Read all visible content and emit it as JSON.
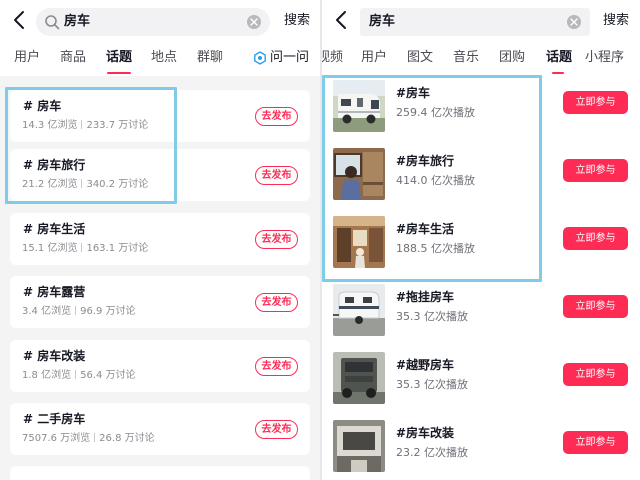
{
  "left": {
    "search": {
      "query": "房车",
      "button": "搜索"
    },
    "tabs": [
      "用户",
      "商品",
      "话题",
      "地点",
      "群聊",
      "问一问"
    ],
    "topics": [
      {
        "title": "# 房车",
        "views": "14.3 亿浏览",
        "discussions": "233.7 万讨论",
        "action": "去发布"
      },
      {
        "title": "# 房车旅行",
        "views": "21.2 亿浏览",
        "discussions": "340.2 万讨论",
        "action": "去发布"
      },
      {
        "title": "# 房车生活",
        "views": "15.1 亿浏览",
        "discussions": "163.1 万讨论",
        "action": "去发布"
      },
      {
        "title": "# 房车露营",
        "views": "3.4 亿浏览",
        "discussions": "96.9 万讨论",
        "action": "去发布"
      },
      {
        "title": "# 房车改装",
        "views": "1.8 亿浏览",
        "discussions": "56.4 万讨论",
        "action": "去发布"
      },
      {
        "title": "# 二手房车",
        "views": "7507.6 万浏览",
        "discussions": "26.8 万讨论",
        "action": "去发布"
      }
    ]
  },
  "right": {
    "search": {
      "query": "房车",
      "button": "搜索"
    },
    "tabs": [
      "视频",
      "用户",
      "图文",
      "音乐",
      "团购",
      "话题",
      "小程序"
    ],
    "topics": [
      {
        "title": "#房车",
        "plays": "259.4 亿次播放",
        "action": "立即参与"
      },
      {
        "title": "#房车旅行",
        "plays": "414.0 亿次播放",
        "action": "立即参与"
      },
      {
        "title": "#房车生活",
        "plays": "188.5 亿次播放",
        "action": "立即参与"
      },
      {
        "title": "#拖挂房车",
        "plays": "35.3 亿次播放",
        "action": "立即参与"
      },
      {
        "title": "#越野房车",
        "plays": "35.3 亿次播放",
        "action": "立即参与"
      },
      {
        "title": "#房车改装",
        "plays": "23.2 亿次播放",
        "action": "立即参与"
      }
    ]
  },
  "colors": {
    "accent": "#fe2c55",
    "highlight": "#7fcbea",
    "ask_icon": "#2a9ef0"
  }
}
